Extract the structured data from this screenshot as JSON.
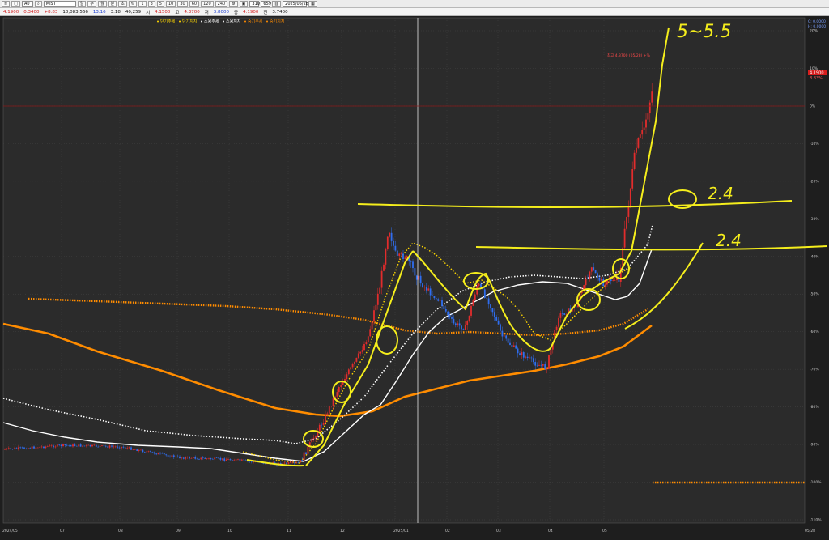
{
  "toolbar": {
    "code": "A0",
    "name": "MIST",
    "tabs": [
      "일",
      "주",
      "월",
      "분",
      "초",
      "틱"
    ],
    "intervals": [
      "1",
      "3",
      "5",
      "10",
      "30",
      "60",
      "120",
      "240"
    ],
    "zoom": "310",
    "total": "659",
    "date": "2025/05/28"
  },
  "quote": {
    "price": "4.1900",
    "change": "0.3400",
    "change_pct": "+8.83",
    "volume": "10,083,566",
    "vol_pct": "13.16",
    "amount": "3.18",
    "amount2": "40,259",
    "open_label": "시",
    "open": "4.1500",
    "high_label": "고",
    "high": "4.3700",
    "low_label": "저",
    "low": "3.8000",
    "close_label": "종",
    "close": "4.1900",
    "prev_label": "전",
    "prev": "3.7400"
  },
  "legend": {
    "items": [
      {
        "label": "단기추세",
        "color": "#ffd700"
      },
      {
        "label": "단기지지",
        "color": "#ffd700"
      },
      {
        "label": "스윙추세",
        "color": "#ffffff"
      },
      {
        "label": "스윙지지",
        "color": "#ffffff"
      },
      {
        "label": "중기추세",
        "color": "#ff8c00"
      },
      {
        "label": "중기지지",
        "color": "#ff8c00"
      }
    ]
  },
  "annotations": {
    "top_label": "5~5.5",
    "mid_label": "2.4",
    "low_label": "2.4",
    "high_note": "최고 4.3700 (05/28) +%"
  },
  "chart_data": {
    "type": "candlestick",
    "y_axis": {
      "labels": [
        "20%",
        "10%",
        "0%",
        "-10%",
        "-20%",
        "-30%",
        "-40%",
        "-50%",
        "-60%",
        "-70%",
        "-80%",
        "-90%",
        "-100%",
        "-110%"
      ],
      "values": [
        20,
        10,
        0,
        -10,
        -20,
        -30,
        -40,
        -50,
        -60,
        -70,
        -80,
        -90,
        -100,
        -110
      ]
    },
    "x_axis": {
      "labels": [
        "2024/05",
        "07",
        "08",
        "09",
        "10",
        "11",
        "12",
        "2025/01",
        "02",
        "03",
        "04",
        "05",
        "05/28"
      ]
    },
    "price_tag": "4.1900",
    "price_tag_pct": "8.83%",
    "corner_labels": [
      "C: 0.0000",
      "H: 0.0000"
    ]
  }
}
